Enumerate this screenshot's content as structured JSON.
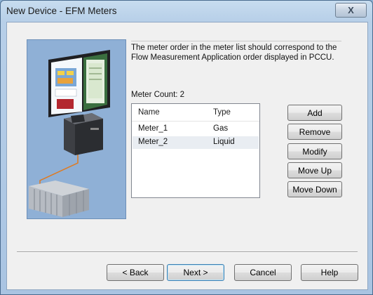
{
  "window": {
    "title": "New Device - EFM Meters",
    "close_glyph": "X"
  },
  "content": {
    "info_text": "The meter order in the meter list should correspond to the Flow Measurement Application order displayed in PCCU.",
    "meter_count": "Meter Count: 2"
  },
  "meter_list": {
    "columns": [
      "Name",
      "Type"
    ],
    "rows": [
      {
        "name": "Meter_1",
        "type": "Gas"
      },
      {
        "name": "Meter_2",
        "type": "Liquid"
      }
    ]
  },
  "side_buttons": {
    "add": "Add",
    "remove": "Remove",
    "modify": "Modify",
    "move_up": "Move Up",
    "move_down": "Move Down"
  },
  "footer": {
    "back": "< Back",
    "next": "Next >",
    "cancel": "Cancel",
    "help": "Help"
  },
  "colors": {
    "accent": "#3c7fb1",
    "illustration_bg": "#8fb0d6"
  },
  "illustration_icon": "computer-plc-connection-icon"
}
